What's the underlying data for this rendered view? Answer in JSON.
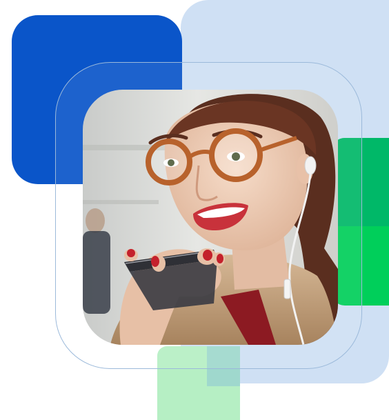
{
  "colors": {
    "dark_blue": "#0a55c9",
    "light_blue": "#cfe0f4",
    "bright_green": "#00cf5a",
    "deep_green": "#00b868",
    "mint": "#b6efc4",
    "mint_overlap": "#9fd8cd",
    "outline": "#9bb9da"
  },
  "photo": {
    "subject": "woman-speaking-into-phone-icon",
    "accessory_icons": [
      "glasses-icon",
      "earphone-icon",
      "smartphone-icon"
    ]
  }
}
